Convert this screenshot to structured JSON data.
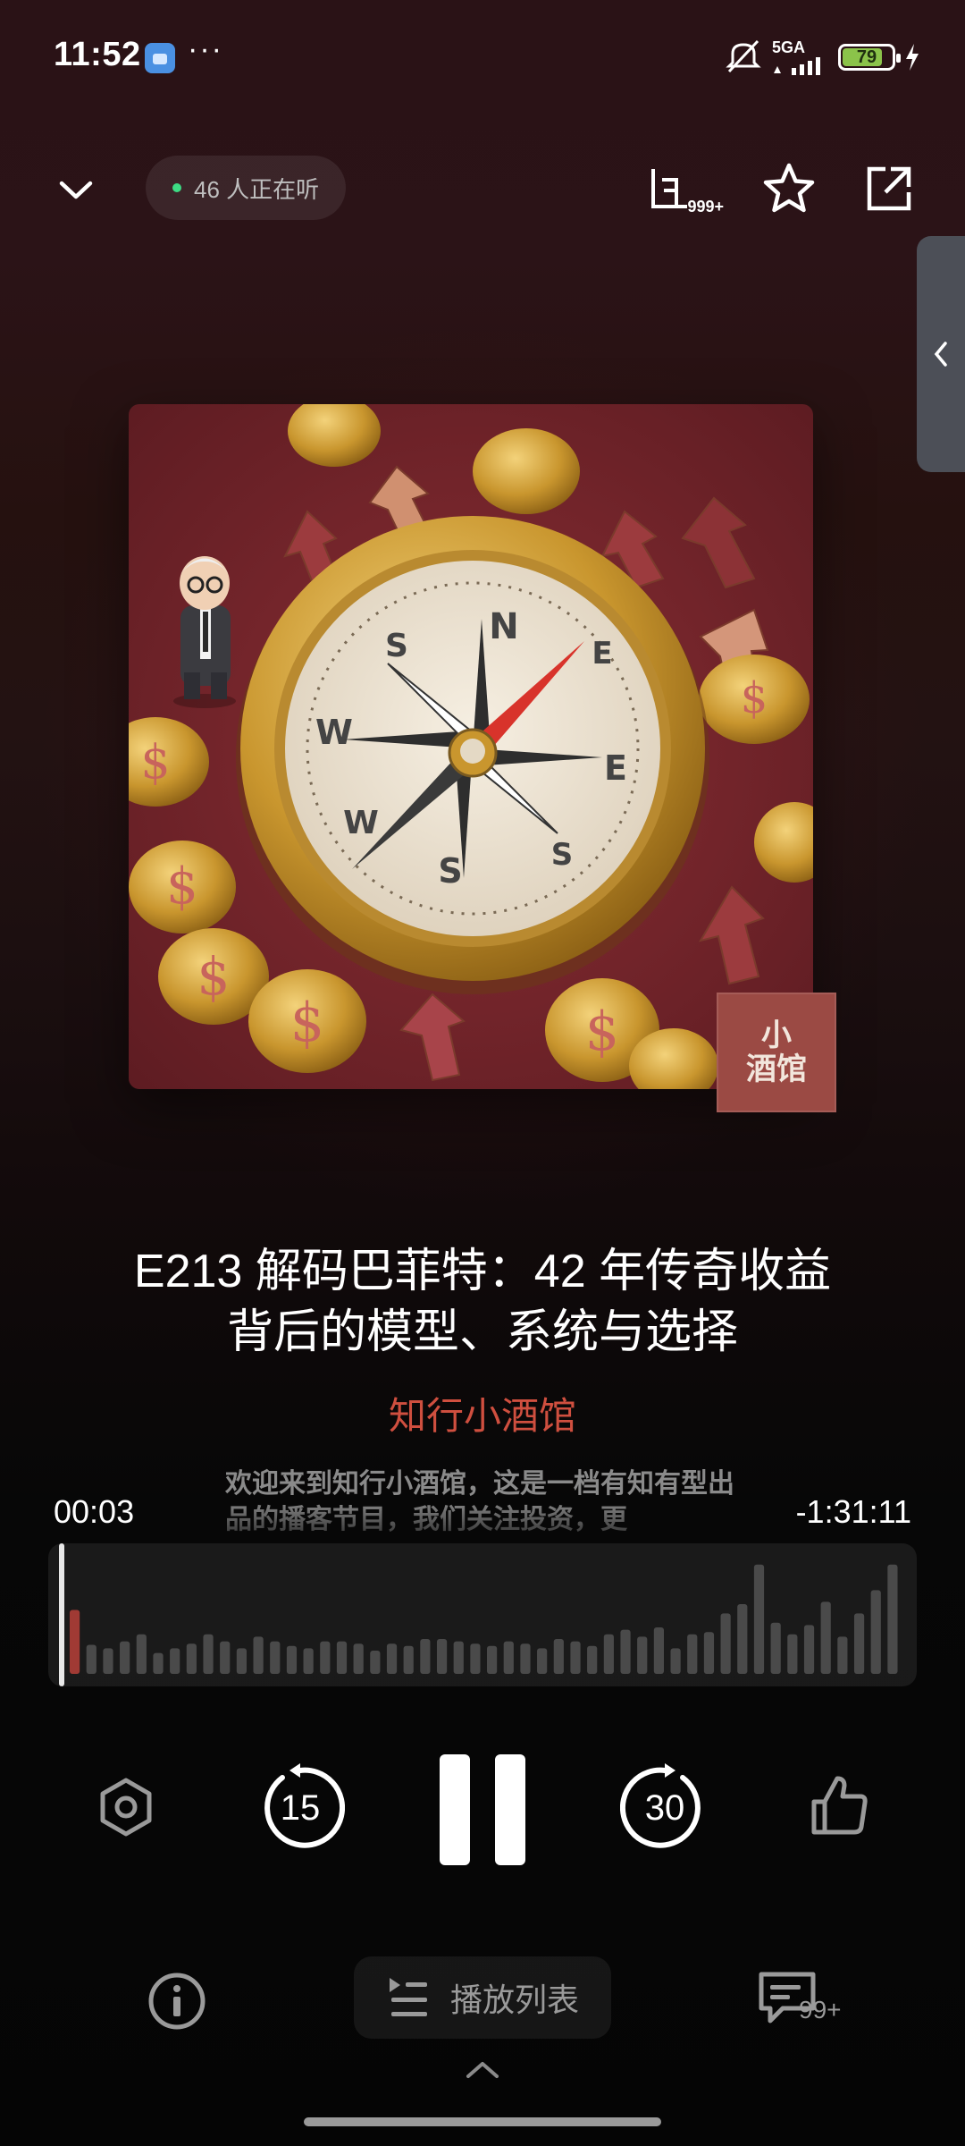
{
  "status_bar": {
    "time": "11:52",
    "dots": "···",
    "network": "5GA",
    "battery": "79",
    "icons": [
      "app-notification-icon",
      "mute-icon",
      "signal-icon",
      "battery-icon",
      "charging-icon"
    ]
  },
  "header": {
    "listeners": "46 人正在听",
    "subscribe_count": "999+",
    "icons": [
      "chevron-down-icon",
      "subscribe-icon",
      "star-icon",
      "share-icon",
      "chevron-left-icon"
    ]
  },
  "cover": {
    "logo_line1": "小",
    "logo_line2": "酒馆",
    "compass_letters": [
      "N",
      "S",
      "E",
      "W",
      "S",
      "S",
      "W",
      "E"
    ],
    "coin_symbol": "$"
  },
  "episode": {
    "title": "E213 解码巴菲特：42 年传奇收益背后的模型、系统与选择",
    "podcast": "知行小酒馆"
  },
  "player": {
    "elapsed": "00:03",
    "remaining": "-1:31:11",
    "transcript": "欢迎来到知行小酒馆，这是一档有知有型出品的播客节目，我们关注投资，更",
    "progress": 0.001,
    "waveform_levels": [
      0.55,
      0.25,
      0.22,
      0.28,
      0.34,
      0.18,
      0.22,
      0.26,
      0.34,
      0.28,
      0.22,
      0.32,
      0.28,
      0.24,
      0.22,
      0.28,
      0.28,
      0.26,
      0.2,
      0.26,
      0.24,
      0.3,
      0.3,
      0.28,
      0.26,
      0.24,
      0.28,
      0.26,
      0.22,
      0.3,
      0.28,
      0.24,
      0.34,
      0.38,
      0.32,
      0.4,
      0.22,
      0.34,
      0.36,
      0.52,
      0.6,
      0.94,
      0.44,
      0.34,
      0.42,
      0.62,
      0.32,
      0.52,
      0.72,
      0.94
    ]
  },
  "controls": {
    "skip_back": "15",
    "skip_forward": "30",
    "icons": [
      "speed-icon",
      "skip-back-15-icon",
      "pause-icon",
      "skip-forward-30-icon",
      "thumbs-up-icon"
    ]
  },
  "bottom": {
    "playlist": "播放列表",
    "comments": "99+",
    "icons": [
      "info-icon",
      "playlist-icon",
      "comment-icon",
      "chevron-up-icon"
    ]
  },
  "colors": {
    "accent": "#cf4f3f",
    "background_top": "#2a1216",
    "background_bottom": "#050505"
  }
}
